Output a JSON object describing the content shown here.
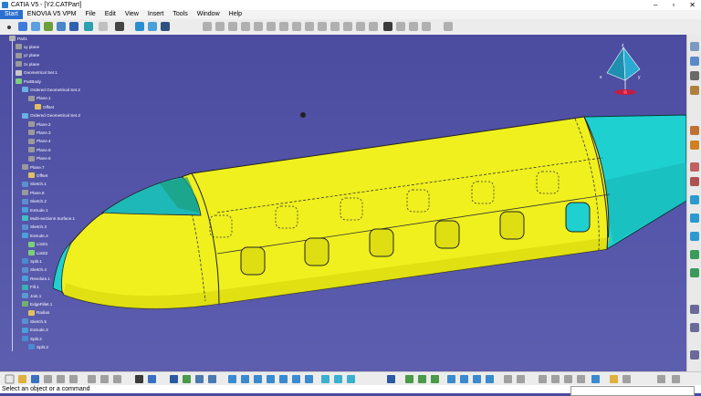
{
  "window": {
    "title": "CATIA V5 - [Y2.CATPart]",
    "controls": [
      "–",
      "▫",
      "✕"
    ]
  },
  "menu": [
    "Start",
    "ENOVIA V5 VPM",
    "File",
    "Edit",
    "View",
    "Insert",
    "Tools",
    "Window",
    "Help"
  ],
  "tree": [
    {
      "label": "Part1",
      "icon": "part-icon",
      "indent": 0
    },
    {
      "label": "xy plane",
      "icon": "plane-icon",
      "indent": 1
    },
    {
      "label": "yz plane",
      "icon": "plane-icon",
      "indent": 1
    },
    {
      "label": "zx plane",
      "icon": "plane-icon",
      "indent": 1
    },
    {
      "label": "Geometrical Set.1",
      "icon": "geoset-icon",
      "indent": 1
    },
    {
      "label": "PartBody",
      "icon": "body-icon",
      "indent": 1
    },
    {
      "label": "Ordered Geometrical Set.2",
      "icon": "ogs-icon",
      "indent": 2
    },
    {
      "label": "Plane.1",
      "icon": "plane-icon",
      "indent": 3
    },
    {
      "label": "Offset",
      "icon": "offset-icon",
      "indent": 4
    },
    {
      "label": "Ordered Geometrical Set.3",
      "icon": "ogs-icon",
      "indent": 2
    },
    {
      "label": "Plane.2",
      "icon": "plane-icon",
      "indent": 3
    },
    {
      "label": "Plane.3",
      "icon": "plane-icon",
      "indent": 3
    },
    {
      "label": "Plane.4",
      "icon": "plane-icon",
      "indent": 3
    },
    {
      "label": "Plane.5",
      "icon": "plane-icon",
      "indent": 3
    },
    {
      "label": "Plane.6",
      "icon": "plane-icon",
      "indent": 3
    },
    {
      "label": "Plane.7",
      "icon": "plane-icon",
      "indent": 2
    },
    {
      "label": "Offset",
      "icon": "offset-icon",
      "indent": 3
    },
    {
      "label": "Sketch.1",
      "icon": "sketch-icon",
      "indent": 2
    },
    {
      "label": "Plane.8",
      "icon": "plane-icon",
      "indent": 2
    },
    {
      "label": "Sketch.2",
      "icon": "sketch-icon",
      "indent": 2
    },
    {
      "label": "Extrude.1",
      "icon": "extrude-icon",
      "indent": 2
    },
    {
      "label": "Multi-sections Surface.1",
      "icon": "multisection-icon",
      "indent": 2
    },
    {
      "label": "Sketch.3",
      "icon": "sketch-icon",
      "indent": 2
    },
    {
      "label": "Extrude.2",
      "icon": "extrude-icon",
      "indent": 2
    },
    {
      "label": "Limit1",
      "icon": "limit-icon",
      "indent": 3
    },
    {
      "label": "Limit2",
      "icon": "limit-icon",
      "indent": 3
    },
    {
      "label": "Split.1",
      "icon": "split-icon",
      "indent": 2
    },
    {
      "label": "Sketch.4",
      "icon": "sketch-icon",
      "indent": 2
    },
    {
      "label": "Revolute.1",
      "icon": "revolute-icon",
      "indent": 2
    },
    {
      "label": "Fill.1",
      "icon": "fill-icon",
      "indent": 2
    },
    {
      "label": "Join.1",
      "icon": "join-icon",
      "indent": 2
    },
    {
      "label": "EdgeFillet.1",
      "icon": "fillet-icon",
      "indent": 2
    },
    {
      "label": "Radius",
      "icon": "radius-icon",
      "indent": 3
    },
    {
      "label": "Sketch.5",
      "icon": "sketch-icon",
      "indent": 2
    },
    {
      "label": "Extrude.3",
      "icon": "extrude-icon",
      "indent": 2
    },
    {
      "label": "Split.2",
      "icon": "split-icon",
      "indent": 2
    },
    {
      "label": "Split.3",
      "icon": "split-icon",
      "indent": 3
    }
  ],
  "status": {
    "message": "Select an object or a command",
    "command_value": ""
  },
  "colors": {
    "background": "#4b4b9f",
    "fuselage": "#f0f01e",
    "fuselage_shadow": "#d9d90f",
    "tail": "#1fcfcf",
    "accent": "#2a6fd0"
  },
  "compass": {
    "axes": [
      "x",
      "y",
      "z"
    ]
  }
}
